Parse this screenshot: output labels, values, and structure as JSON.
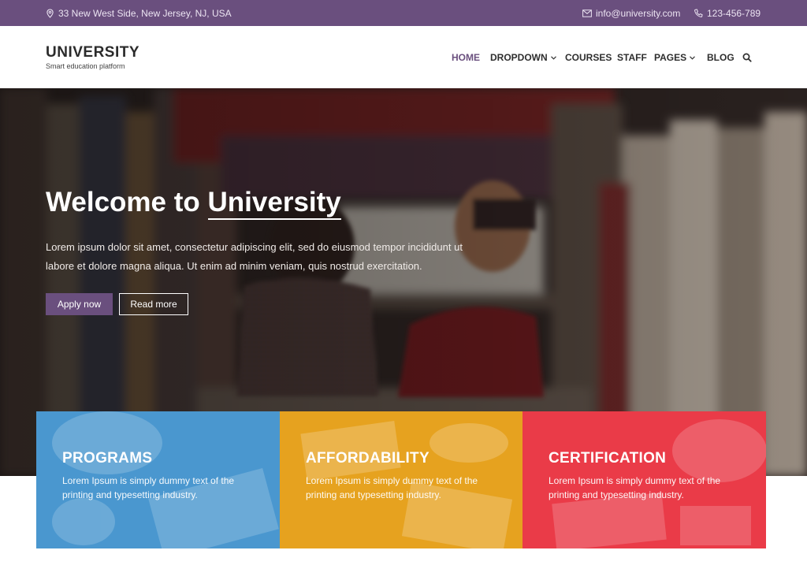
{
  "topbar": {
    "address": "33 New West Side, New Jersey, NJ, USA",
    "email": "info@university.com",
    "phone": "123-456-789",
    "icons": [
      "location-pin-icon",
      "envelope-icon",
      "phone-icon"
    ]
  },
  "brand": {
    "name": "UNIVERSITY",
    "tagline": "Smart education platform"
  },
  "nav": {
    "items": [
      {
        "label": "HOME",
        "active": true
      },
      {
        "label": "DROPDOWN",
        "has_dropdown": true
      },
      {
        "label": "COURSES"
      },
      {
        "label": "STAFF"
      },
      {
        "label": "PAGES",
        "has_dropdown": true
      },
      {
        "label": "BLOG"
      }
    ],
    "search_icon": "search-icon"
  },
  "hero": {
    "title_prefix": "Welcome to ",
    "title_highlight": "University",
    "text": "Lorem ipsum dolor sit amet, consectetur adipiscing elit, sed do eiusmod tempor incididunt ut labore et dolore magna aliqua. Ut enim ad minim veniam, quis nostrud exercitation.",
    "apply_label": "Apply now",
    "more_label": "Read more"
  },
  "features": [
    {
      "title": "PROGRAMS",
      "text": "Lorem Ipsum is simply dummy text of the printing and typesetting industry.",
      "color": "#4a97cf"
    },
    {
      "title": "AFFORDABILITY",
      "text": "Lorem Ipsum is simply dummy text of the printing and typesetting industry.",
      "color": "#e6a21f"
    },
    {
      "title": "CERTIFICATION",
      "text": "Lorem Ipsum is simply dummy text of the printing and typesetting industry.",
      "color": "#ea3b48"
    }
  ],
  "colors": {
    "brand_purple": "#6a4f7e",
    "dark_text": "#2b2b2b"
  }
}
